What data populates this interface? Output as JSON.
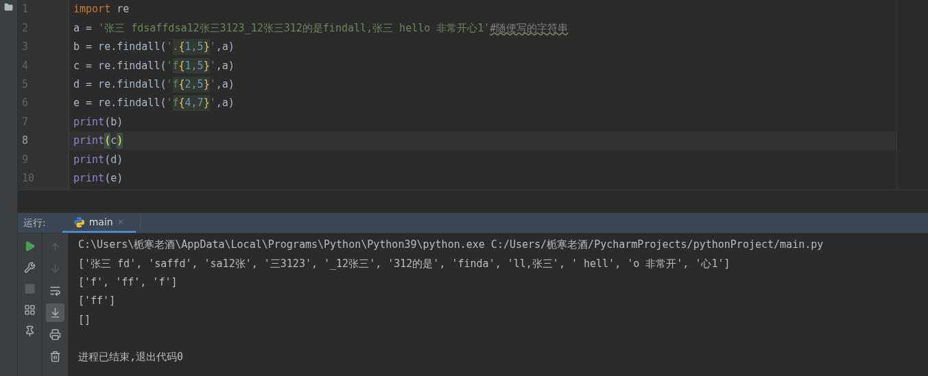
{
  "editor": {
    "lines": [
      {
        "number": "1",
        "current": false,
        "segments": [
          {
            "kind": "keyword",
            "text": "import"
          },
          {
            "kind": "plain",
            "text": " re"
          }
        ]
      },
      {
        "number": "2",
        "current": false,
        "segments": [
          {
            "kind": "plain",
            "text": "a = "
          },
          {
            "kind": "string",
            "text": "'张三 fdsaffdsa12张三3123_12张三312的是findall,张三 hello 非常开心1'"
          },
          {
            "kind": "comment",
            "text": "#随便写的字符串"
          }
        ]
      },
      {
        "number": "3",
        "current": false,
        "segments": [
          {
            "kind": "plain",
            "text": "b = re.findall("
          },
          {
            "kind": "string",
            "text": "'"
          },
          {
            "kind": "regex_char",
            "text": "."
          },
          {
            "kind": "regex_brace",
            "text": "{"
          },
          {
            "kind": "regex_num",
            "text": "1,5"
          },
          {
            "kind": "regex_brace",
            "text": "}"
          },
          {
            "kind": "string",
            "text": "'"
          },
          {
            "kind": "plain",
            "text": ",a)"
          }
        ]
      },
      {
        "number": "4",
        "current": false,
        "segments": [
          {
            "kind": "plain",
            "text": "c = re.findall("
          },
          {
            "kind": "string",
            "text": "'"
          },
          {
            "kind": "regex_char",
            "text": "f"
          },
          {
            "kind": "regex_brace",
            "text": "{"
          },
          {
            "kind": "regex_num",
            "text": "1,5"
          },
          {
            "kind": "regex_brace",
            "text": "}"
          },
          {
            "kind": "string",
            "text": "'"
          },
          {
            "kind": "plain",
            "text": ",a)"
          }
        ]
      },
      {
        "number": "5",
        "current": false,
        "segments": [
          {
            "kind": "plain",
            "text": "d = re.findall("
          },
          {
            "kind": "string",
            "text": "'"
          },
          {
            "kind": "regex_char",
            "text": "f"
          },
          {
            "kind": "regex_brace",
            "text": "{"
          },
          {
            "kind": "regex_num",
            "text": "2,5"
          },
          {
            "kind": "regex_brace",
            "text": "}"
          },
          {
            "kind": "string",
            "text": "'"
          },
          {
            "kind": "plain",
            "text": ",a)"
          }
        ]
      },
      {
        "number": "6",
        "current": false,
        "segments": [
          {
            "kind": "plain",
            "text": "e = re.findall("
          },
          {
            "kind": "string",
            "text": "'"
          },
          {
            "kind": "regex_char",
            "text": "f"
          },
          {
            "kind": "regex_brace",
            "text": "{"
          },
          {
            "kind": "regex_num",
            "text": "4,7"
          },
          {
            "kind": "regex_brace",
            "text": "}"
          },
          {
            "kind": "string",
            "text": "'"
          },
          {
            "kind": "plain",
            "text": ",a)"
          }
        ]
      },
      {
        "number": "7",
        "current": false,
        "segments": [
          {
            "kind": "builtin",
            "text": "print"
          },
          {
            "kind": "plain",
            "text": "(b)"
          }
        ]
      },
      {
        "number": "8",
        "current": true,
        "segments": [
          {
            "kind": "builtin",
            "text": "print"
          },
          {
            "kind": "match",
            "text": "("
          },
          {
            "kind": "plain",
            "text": "c"
          },
          {
            "kind": "match",
            "text": ")"
          }
        ]
      },
      {
        "number": "9",
        "current": false,
        "segments": [
          {
            "kind": "builtin",
            "text": "print"
          },
          {
            "kind": "plain",
            "text": "(d)"
          }
        ]
      },
      {
        "number": "10",
        "current": false,
        "segments": [
          {
            "kind": "builtin",
            "text": "print"
          },
          {
            "kind": "plain",
            "text": "(e)"
          }
        ]
      }
    ]
  },
  "run_panel": {
    "label": "运行:",
    "tabs": [
      {
        "label": "main",
        "selected": true,
        "close": "×"
      }
    ],
    "tools": [
      {
        "kind": "run",
        "disabled": false
      },
      {
        "kind": "wrench",
        "disabled": false
      },
      {
        "kind": "stop",
        "disabled": true
      },
      {
        "kind": "layout",
        "disabled": false
      },
      {
        "kind": "pin",
        "disabled": false
      }
    ],
    "console_tools": [
      {
        "kind": "up",
        "selected": false,
        "disabled": true
      },
      {
        "kind": "down",
        "selected": false,
        "disabled": true
      },
      {
        "kind": "wrap",
        "selected": false,
        "disabled": false
      },
      {
        "kind": "scroll_end",
        "selected": true,
        "disabled": false
      },
      {
        "kind": "print",
        "selected": false,
        "disabled": false
      },
      {
        "kind": "trash",
        "selected": false,
        "disabled": false
      }
    ],
    "output": [
      "C:\\Users\\栀寒老酒\\AppData\\Local\\Programs\\Python\\Python39\\python.exe C:/Users/栀寒老酒/PycharmProjects/pythonProject/main.py",
      "['张三 fd', 'saffd', 'sa12张', '三3123', '_12张三', '312的是', 'finda', 'll,张三', ' hell', 'o 非常开', '心1']",
      "['f', 'ff', 'f']",
      "['ff']",
      "[]"
    ],
    "exit_message": "进程已结束,退出代码0"
  }
}
